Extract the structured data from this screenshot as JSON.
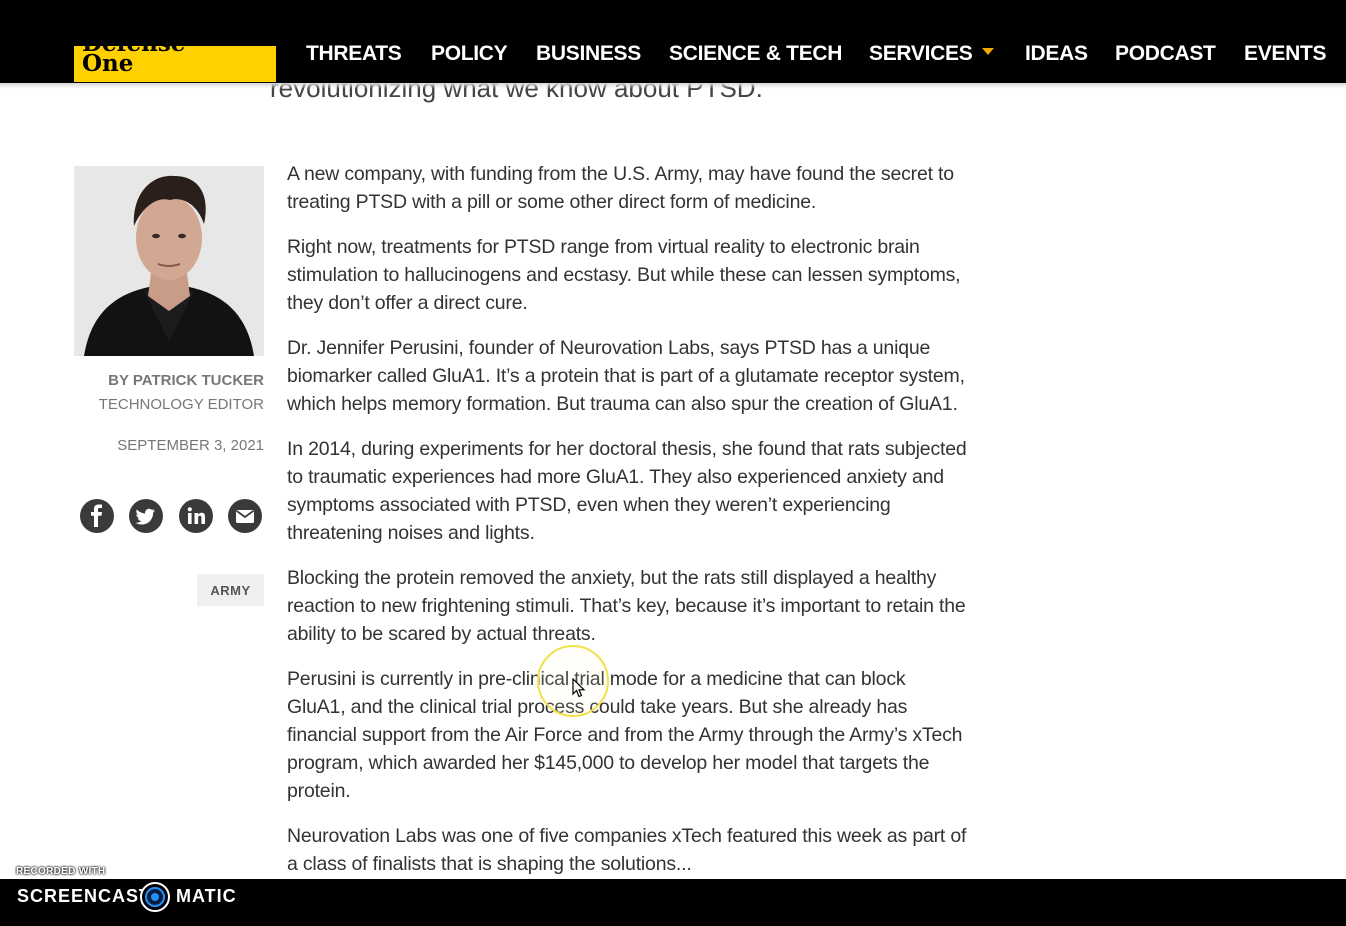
{
  "site": {
    "logo_line1": "Defense",
    "logo_line2": "One"
  },
  "nav": {
    "items": [
      {
        "label": "THREATS"
      },
      {
        "label": "POLICY"
      },
      {
        "label": "BUSINESS"
      },
      {
        "label": "SCIENCE & TECH"
      },
      {
        "label": "SERVICES"
      },
      {
        "label": "IDEAS"
      },
      {
        "label": "PODCAST"
      },
      {
        "label": "EVENTS"
      }
    ],
    "caret_color": "#f2a900"
  },
  "article": {
    "subtitle": "revolutionizing what we know about PTSD.",
    "author_name": "BY PATRICK TUCKER",
    "author_role": "TECHNOLOGY EDITOR",
    "date": "SEPTEMBER 3, 2021",
    "tag": "ARMY",
    "share_icons": [
      "facebook-icon",
      "twitter-icon",
      "linkedin-icon",
      "email-icon"
    ],
    "paragraphs": [
      "A new company, with funding from the U.S. Army, may have found the secret to treating PTSD with a pill or some other direct form of medicine.",
      "Right now, treatments for PTSD range from virtual reality to electronic brain stimulation to hallucinogens and ecstasy. But while these can lessen symptoms, they don’t offer a direct cure.",
      "Dr. Jennifer Perusini, founder of Neurovation Labs, says PTSD has a unique biomarker called GluA1. It’s a protein that is part of a glutamate receptor system, which helps memory formation. But trauma can also spur the creation of GluA1.",
      "In 2014, during experiments for her doctoral thesis, she found that rats subjected to traumatic experiences had more GluA1. They also experienced anxiety and symptoms associated with PTSD, even when they weren’t experiencing threatening noises and lights.",
      "Blocking the protein removed the anxiety, but the rats still displayed a healthy reaction to new frightening stimuli. That’s key, because it’s important to retain the ability to be scared by actual threats.",
      "Perusini is currently in pre-clinical trial mode for a medicine that can block GluA1, and the clinical trial process could take years. But she already has financial support from the Air Force and from the Army through the Army’s xTech program, which awarded her $145,000 to develop her model that targets the protein.",
      "Neurovation Labs was one of five companies xTech featured this week as part of a class of finalists that is shaping the solutions..."
    ]
  },
  "recorder": {
    "small_label": "RECORDED WITH",
    "brand_left": "SCREENCAST",
    "brand_right": "MATIC"
  },
  "colors": {
    "header_bg": "#000000",
    "logo_bg": "#ffd100",
    "cursor_ring": "#f2e14a",
    "recorder_accent": "#1e90ff"
  }
}
